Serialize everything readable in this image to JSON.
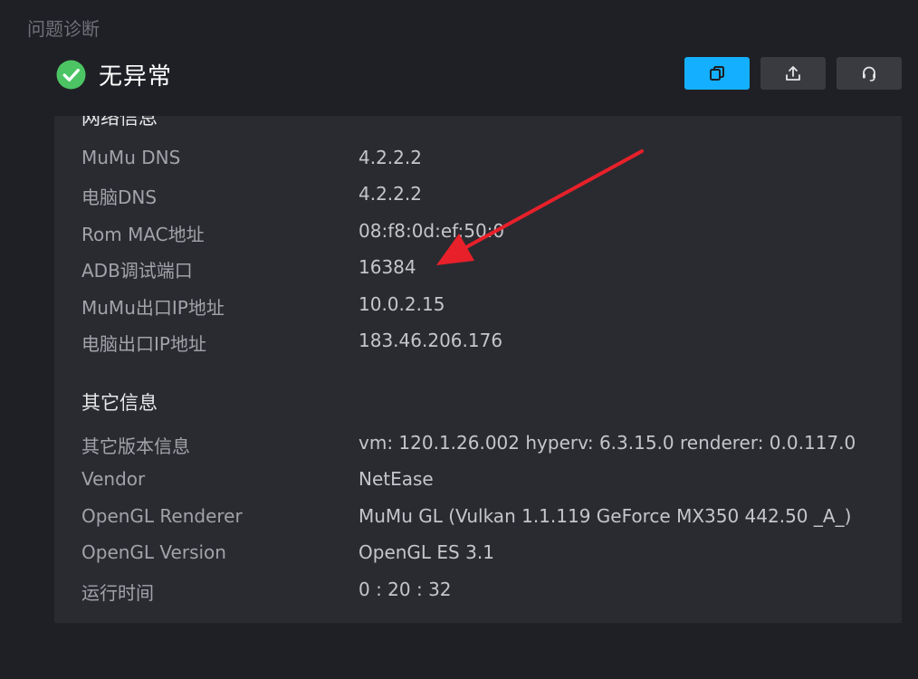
{
  "window": {
    "title": "问题诊断"
  },
  "status": {
    "text": "无异常",
    "icon": "check-circle-icon",
    "color": "#4cc464"
  },
  "toolbar": {
    "buttons": [
      {
        "icon": "copy-icon",
        "active": true
      },
      {
        "icon": "share-icon",
        "active": false
      },
      {
        "icon": "support-headset-icon",
        "active": false
      }
    ],
    "accent": "#14b0ff"
  },
  "network": {
    "title": "网络信息",
    "rows": [
      {
        "label": "MuMu DNS",
        "value": "4.2.2.2"
      },
      {
        "label": "电脑DNS",
        "value": "4.2.2.2"
      },
      {
        "label": "Rom MAC地址",
        "value": "08:f8:0d:ef:50:0"
      },
      {
        "label": "ADB调试端口",
        "value": "16384"
      },
      {
        "label": "MuMu出口IP地址",
        "value": "10.0.2.15"
      },
      {
        "label": "电脑出口IP地址",
        "value": "183.46.206.176"
      }
    ]
  },
  "other": {
    "title": "其它信息",
    "rows": [
      {
        "label": "其它版本信息",
        "value": "vm: 120.1.26.002 hyperv: 6.3.15.0 renderer: 0.0.117.0"
      },
      {
        "label": "Vendor",
        "value": "NetEase"
      },
      {
        "label": "OpenGL Renderer",
        "value": "MuMu GL (Vulkan 1.1.119 GeForce MX350 442.50 _A_)"
      },
      {
        "label": "OpenGL Version",
        "value": "OpenGL ES 3.1"
      },
      {
        "label": "运行时间",
        "value": "0 : 20 : 32"
      }
    ]
  },
  "annotation": {
    "type": "arrow",
    "color": "#e8202a"
  }
}
